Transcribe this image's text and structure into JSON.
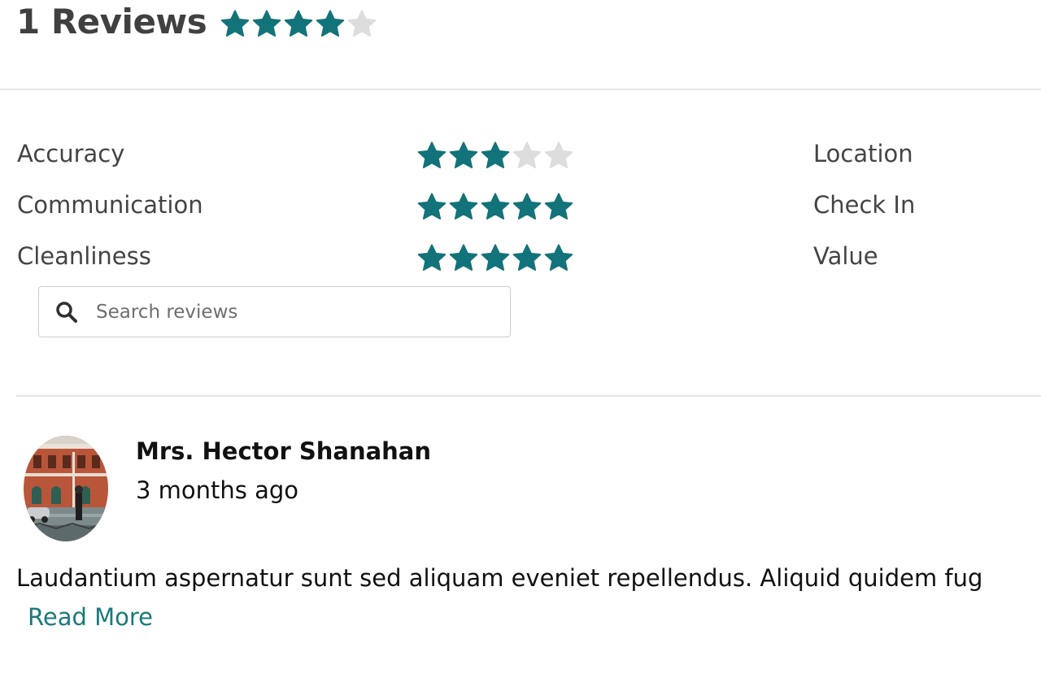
{
  "header": {
    "title": "1 Reviews",
    "overall_rating": 4,
    "max_rating": 5
  },
  "colors": {
    "star_filled": "#13737a",
    "star_empty": "#dddddd",
    "link": "#1a7a7b",
    "divider": "#e6e6e6"
  },
  "categories_left": [
    {
      "label": "Accuracy",
      "rating": 3
    },
    {
      "label": "Communication",
      "rating": 5
    },
    {
      "label": "Cleanliness",
      "rating": 5
    }
  ],
  "categories_right": [
    {
      "label": "Location"
    },
    {
      "label": "Check In"
    },
    {
      "label": "Value"
    }
  ],
  "search": {
    "placeholder": "Search reviews",
    "icon": "search-icon"
  },
  "review": {
    "author": "Mrs. Hector Shanahan",
    "date": "3 months ago",
    "text": "Laudantium aspernatur sunt sed aliquam eveniet repellendus. Aliquid quidem fug",
    "read_more": "Read More"
  }
}
